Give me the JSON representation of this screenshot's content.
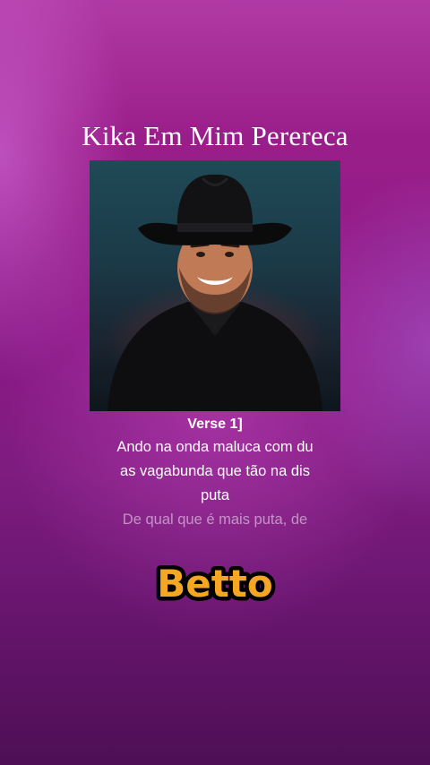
{
  "song": {
    "title": "Kika Em Mim Perereca"
  },
  "cover": {
    "description_icon": "cowboy-portrait"
  },
  "lyrics": {
    "section": "Verse 1]",
    "lines": [
      "Ando na onda maluca com du",
      "as vagabunda que tão na dis",
      "puta"
    ],
    "upcoming": "De qual que é mais puta, de"
  },
  "watermark": {
    "text": "Betto",
    "color": "#f5a623"
  }
}
